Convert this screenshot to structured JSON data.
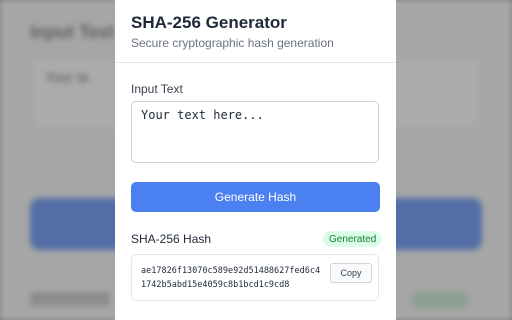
{
  "app": {
    "title": "SHA-256 Generator",
    "subtitle": "Secure cryptographic hash generation"
  },
  "input": {
    "label": "Input Text",
    "value": "Your text here..."
  },
  "actions": {
    "generate_label": "Generate Hash"
  },
  "output": {
    "label": "SHA-256 Hash",
    "status_badge": "Generated",
    "hash_value": "ae17826f13070c589e92d51488627fed6c41742b5abd15e4059c8b1bcd1c9cd8",
    "copy_label": "Copy"
  },
  "background": {
    "title": "Input Text",
    "textarea_text": "Your te"
  },
  "colors": {
    "accent": "#4a80f0",
    "success_bg": "#dcfce7",
    "success_text": "#15803d"
  }
}
